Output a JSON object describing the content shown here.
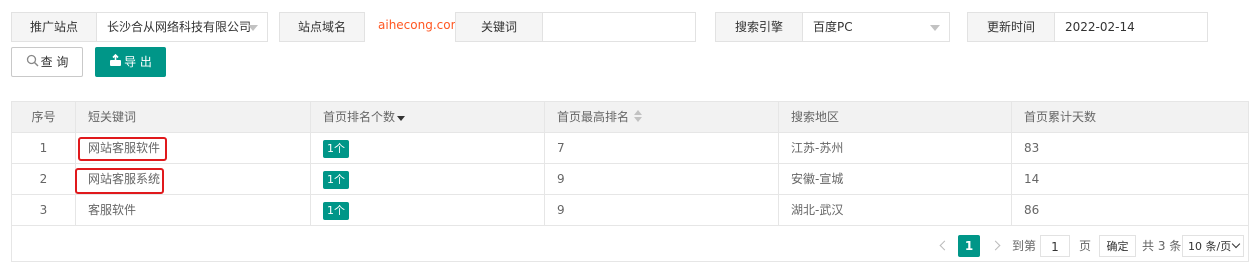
{
  "filters": {
    "site_label": "推广站点",
    "site_value": "长沙合从网络科技有限公司",
    "domain_label": "站点域名",
    "domain_value": "aihecong.com",
    "keyword_label": "关键词",
    "keyword_value": "",
    "engine_label": "搜索引擎",
    "engine_value": "百度PC",
    "update_label": "更新时间",
    "update_value": "2022-02-14"
  },
  "actions": {
    "query_label": "查 询",
    "export_label": "导 出"
  },
  "table": {
    "headers": [
      "序号",
      "短关键词",
      "首页排名个数",
      "首页最高排名",
      "搜索地区",
      "首页累计天数"
    ],
    "rows": [
      {
        "index": "1",
        "keyword": "网站客服软件",
        "count": "1个",
        "best": "7",
        "region": "江苏-苏州",
        "days": "83",
        "highlighted": true
      },
      {
        "index": "2",
        "keyword": "网站客服系统",
        "count": "1个",
        "best": "9",
        "region": "安徽-宣城",
        "days": "14",
        "highlighted": true
      },
      {
        "index": "3",
        "keyword": "客服软件",
        "count": "1个",
        "best": "9",
        "region": "湖北-武汉",
        "days": "86",
        "highlighted": false
      }
    ],
    "sort_column": "首页排名个数",
    "sort_direction": "descending"
  },
  "pager": {
    "prev_icon": "chevron-left-icon",
    "current_page": "1",
    "next_icon": "chevron-right-icon",
    "goto_label": "到第",
    "goto_value": "1",
    "page_unit": "页",
    "confirm_label": "确定",
    "total_label": "共 3 条",
    "page_size": "10 条/页"
  },
  "colors": {
    "accent": "#009688",
    "domain_text": "#ff5722",
    "highlight_box": "#e0191c"
  }
}
